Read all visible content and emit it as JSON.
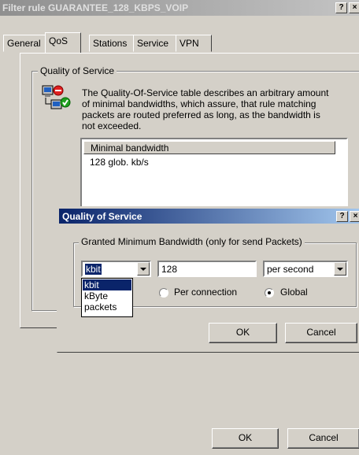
{
  "main_window": {
    "title": "Filter rule GUARANTEE_128_KBPS_VOIP",
    "help_button": "?",
    "close_button": "×",
    "tabs": [
      {
        "label": "General",
        "active": false
      },
      {
        "label": "QoS",
        "active": true
      },
      {
        "label": "Stations",
        "active": false
      },
      {
        "label": "Service",
        "active": false
      },
      {
        "label": "VPN",
        "active": false
      }
    ],
    "group_label": "Quality of Service",
    "description": "The Quality-Of-Service table describes an arbitrary amount of minimal bandwidths, which assure, that rule matching packets are routed preferred as long, as the bandwidth is not exceeded.",
    "list_header": "Minimal bandwidth",
    "list_rows": [
      "128 glob. kb/s"
    ],
    "ok_label": "OK",
    "cancel_label": "Cancel",
    "icon": "network-qos-icon"
  },
  "dialog": {
    "title": "Quality of Service",
    "help_button": "?",
    "close_button": "×",
    "group_label": "Granted Minimum Bandwidth (only for send Packets)",
    "unit_selected": "kbit",
    "unit_options": [
      "kbit",
      "kByte",
      "packets"
    ],
    "amount_value": "128",
    "period_selected": "per second",
    "radio_per_connection": "Per connection",
    "radio_global": "Global",
    "radio_selected": "Global",
    "ok_label": "OK",
    "cancel_label": "Cancel"
  },
  "colors": {
    "dialog_title_active": "#0a246a",
    "main_title_inactive": "#8f8f8f",
    "face": "#d4d0c8"
  }
}
